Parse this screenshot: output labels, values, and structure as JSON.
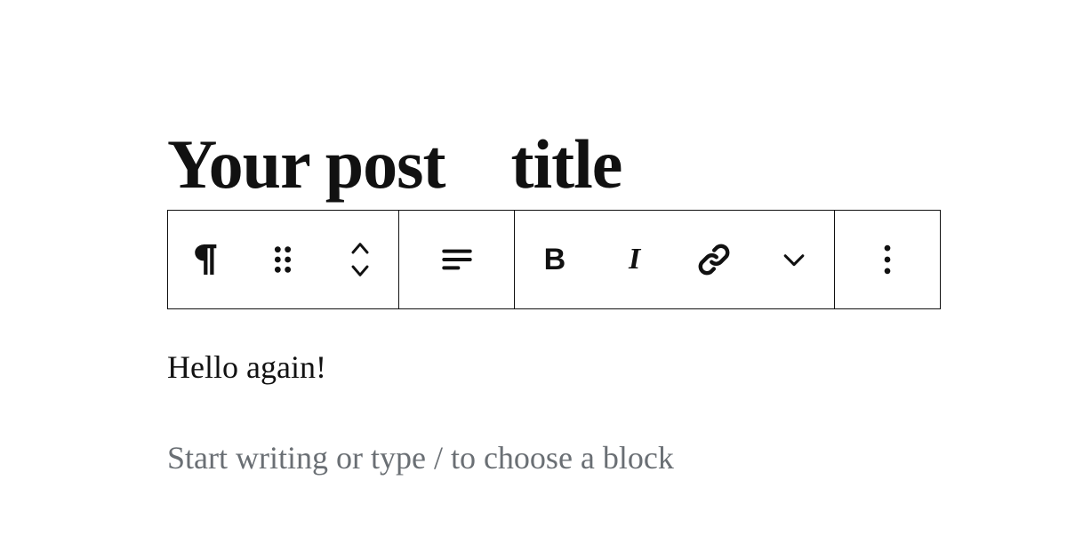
{
  "post": {
    "title": "Your post    title"
  },
  "toolbar": {
    "block_type": "paragraph",
    "drag": "drag-handle",
    "move": "move-up-down",
    "align": "align",
    "bold": "B",
    "italic": "I",
    "link": "link",
    "more_format": "more-formatting",
    "options": "options"
  },
  "content": {
    "paragraph1": "Hello again!",
    "new_block_placeholder": "Start writing or type / to choose a block"
  }
}
